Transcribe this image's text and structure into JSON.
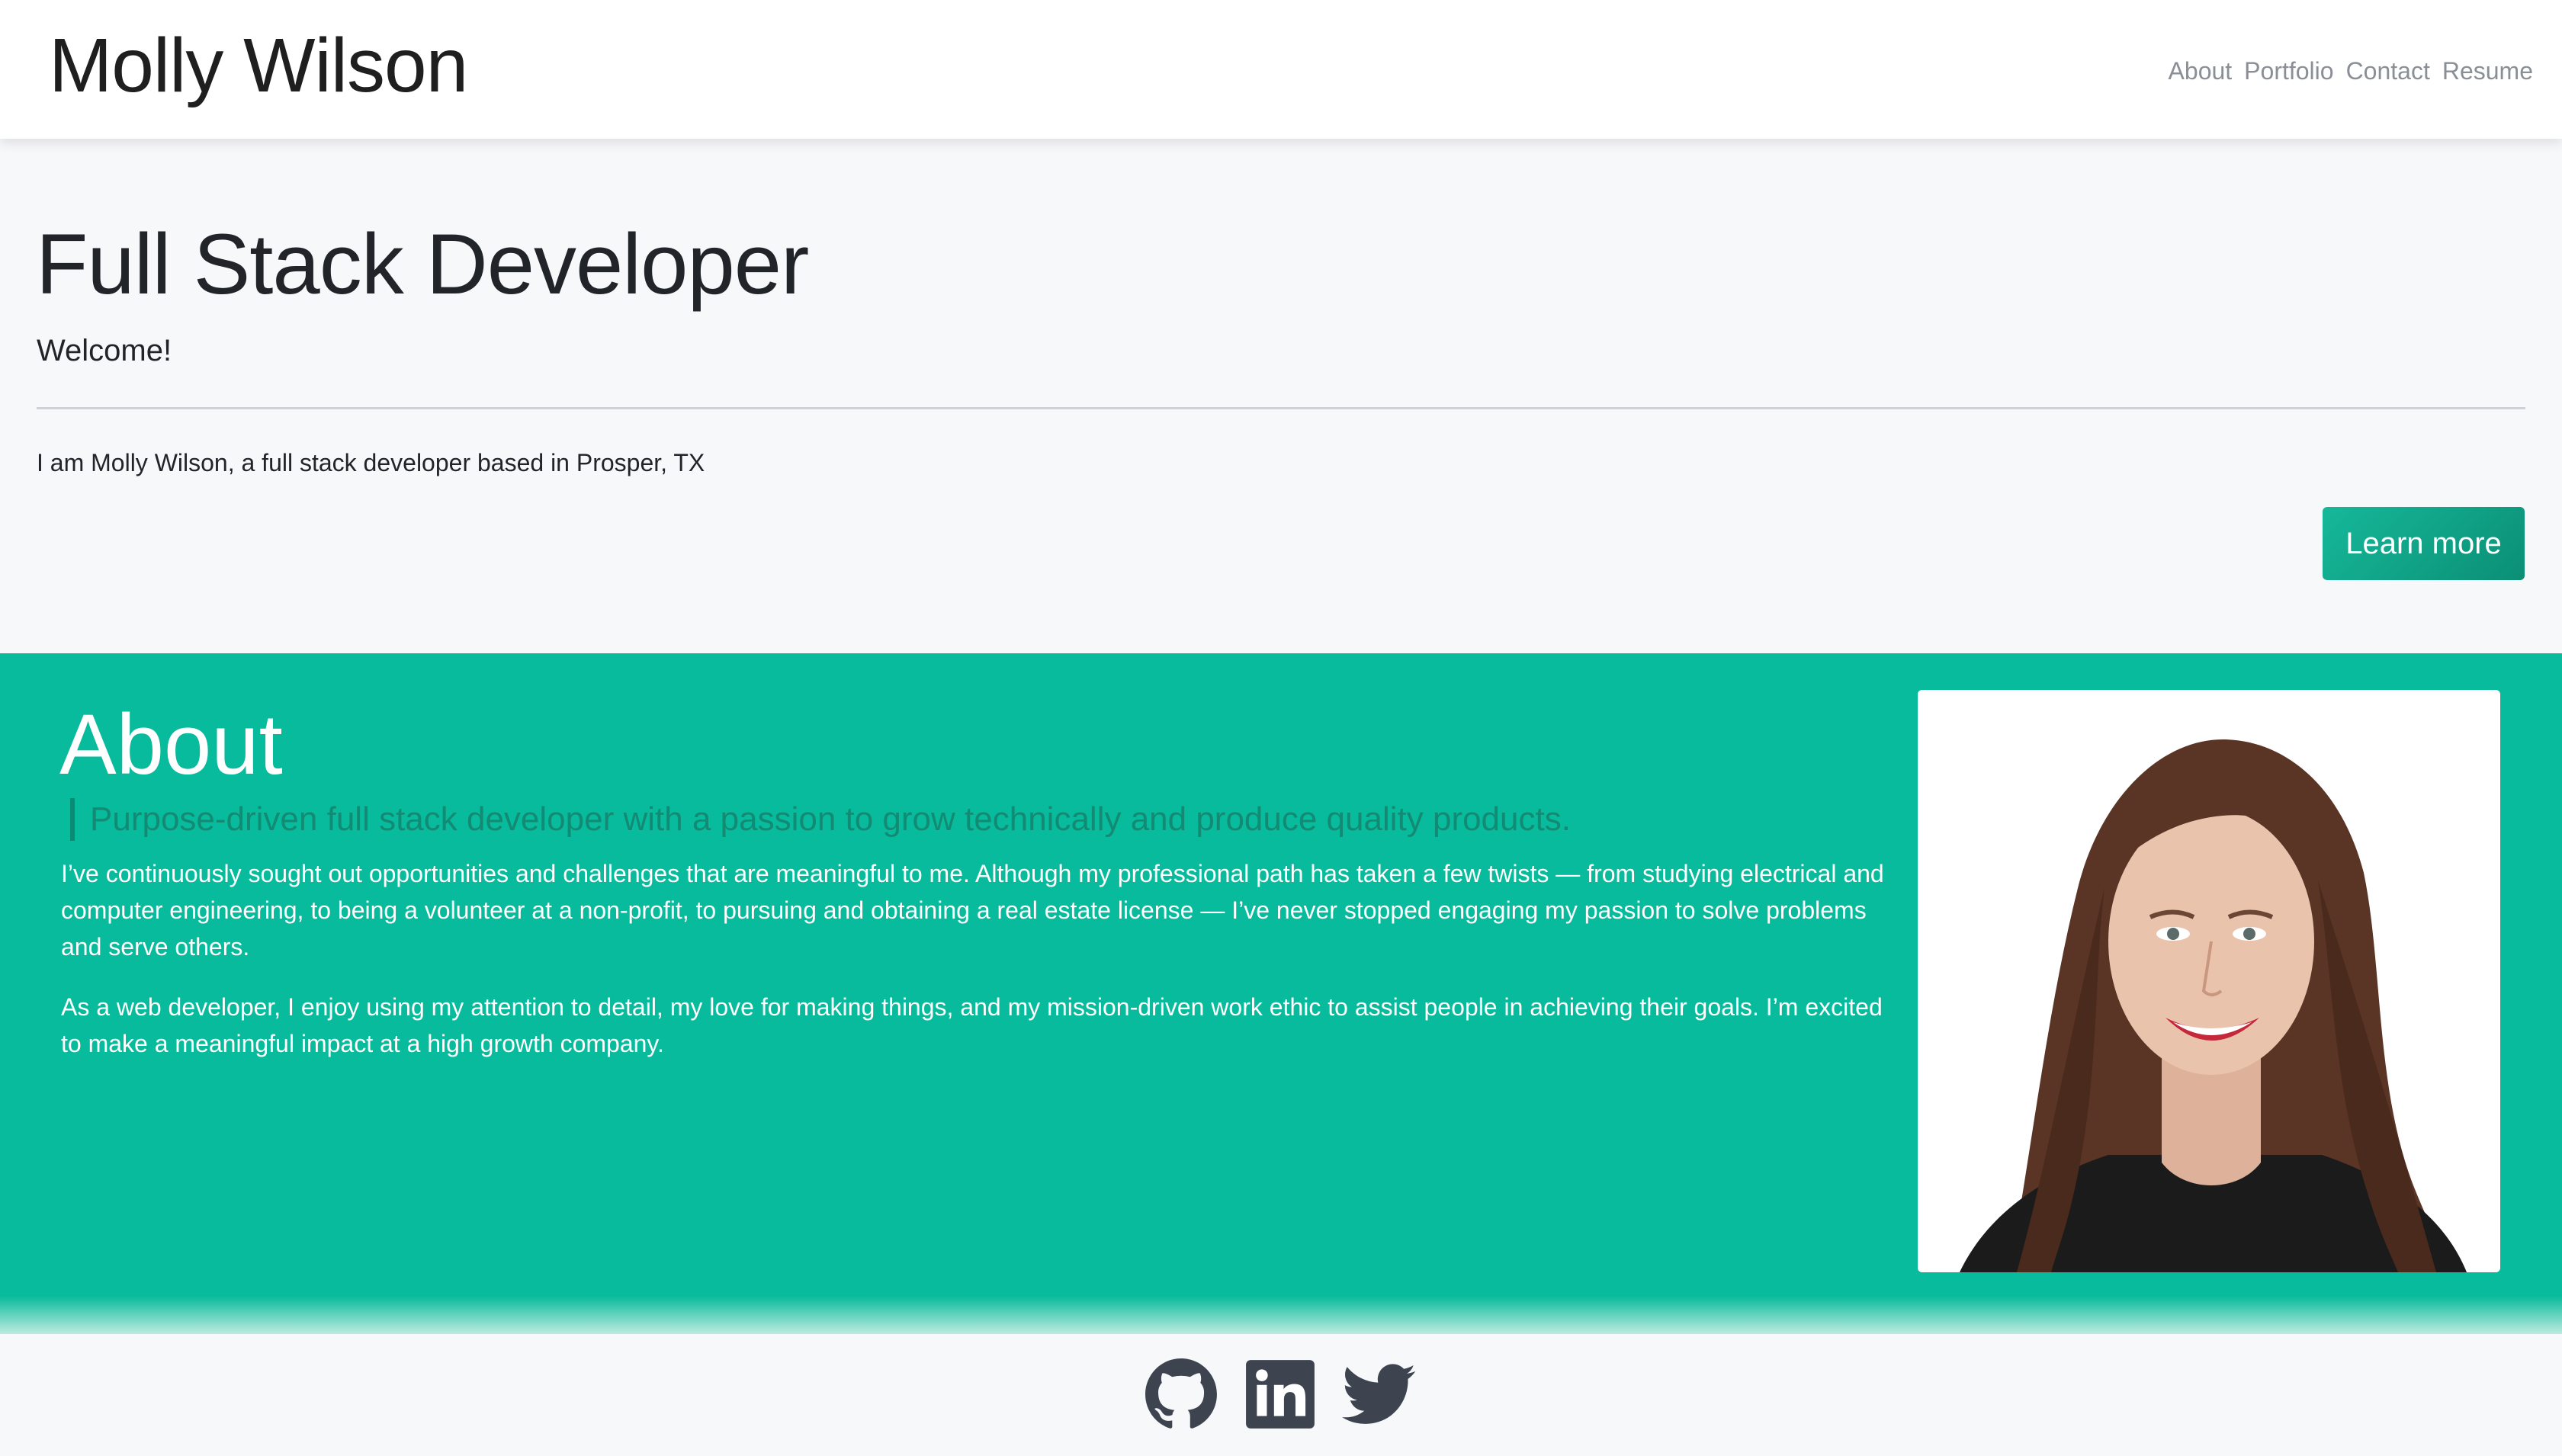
{
  "navbar": {
    "brand": "Molly Wilson",
    "links": [
      {
        "label": "About"
      },
      {
        "label": "Portfolio"
      },
      {
        "label": "Contact"
      },
      {
        "label": "Resume"
      }
    ]
  },
  "hero": {
    "title": "Full Stack Developer",
    "subtitle": "Welcome!",
    "intro": "I am Molly Wilson, a full stack developer based in Prosper, TX",
    "button_label": "Learn more"
  },
  "about": {
    "title": "About",
    "tagline": "Purpose-driven full stack developer with a passion to grow technically and produce quality products.",
    "paragraphs": [
      "I’ve continuously sought out opportunities and challenges that are meaningful to me. Although my professional path has taken a few twists — from studying electrical and computer engineering, to being a volunteer at a non-profit, to pursuing and obtaining a real estate license — I’ve never stopped engaging my passion to solve problems and serve others.",
      "As a web developer, I enjoy using my attention to detail, my love for making things, and my mission-driven work ethic to assist people in achieving their goals. I’m excited to make a meaningful impact at a high growth company."
    ],
    "photo_icon": "profile-photo"
  },
  "footer": {
    "icons": [
      "github-icon",
      "linkedin-icon",
      "twitter-icon"
    ]
  },
  "colors": {
    "accent": "#07bb9c",
    "button": "#0b8f75",
    "icon": "#3d4450"
  }
}
